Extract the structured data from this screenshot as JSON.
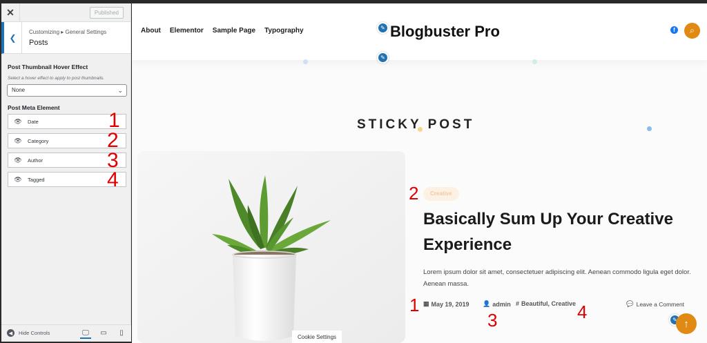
{
  "sidebar": {
    "published_label": "Published",
    "breadcrumb": "Customizing ▸ General Settings",
    "title": "Posts",
    "hover_section_title": "Post Thumbnail Hover Effect",
    "hover_description": "Select a hover effect to apply to post thumbnails.",
    "hover_selected": "None",
    "meta_section_title": "Post Meta Element",
    "meta_items": [
      {
        "label": "Date"
      },
      {
        "label": "Category"
      },
      {
        "label": "Author"
      },
      {
        "label": "Tagged"
      }
    ],
    "hide_controls_label": "Hide Controls"
  },
  "annotations": {
    "sidebar": [
      "1",
      "2",
      "3",
      "4"
    ],
    "preview_category": "2",
    "preview_date": "1",
    "preview_author": "3",
    "preview_tags": "4"
  },
  "site": {
    "nav": [
      "About",
      "Elementor",
      "Sample Page",
      "Typography"
    ],
    "title": "Blogbuster Pro",
    "section_heading": "STICKY POST",
    "cookie_label": "Cookie Settings"
  },
  "post": {
    "category": "Creative",
    "title": "Basically Sum Up Your Creative Experience",
    "excerpt": "Lorem ipsum dolor sit amet, consectetuer adipiscing elit. Aenean commodo ligula eget dolor. Aenean massa.",
    "date": "May 19, 2019",
    "author": "admin",
    "tags": "Beautiful, Creative",
    "comment_label": "Leave a Comment"
  },
  "colors": {
    "accent": "#e08a14",
    "customizer_blue": "#2271b1",
    "annotation_red": "#e00000"
  }
}
